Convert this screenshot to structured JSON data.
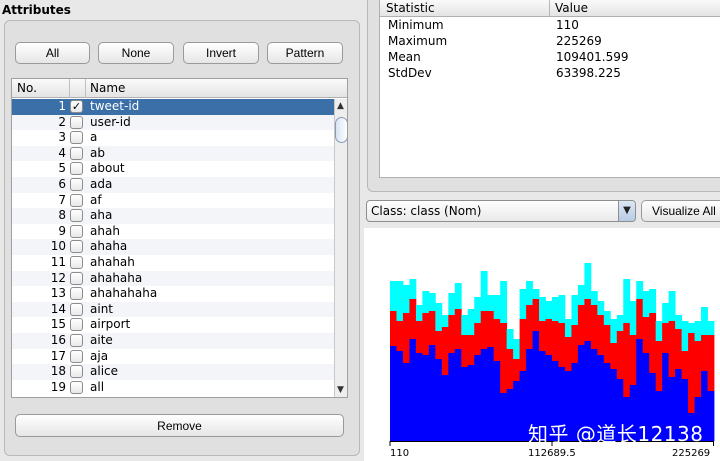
{
  "attributes": {
    "title": "Attributes",
    "buttons": {
      "all": "All",
      "none": "None",
      "invert": "Invert",
      "pattern": "Pattern",
      "remove": "Remove"
    },
    "columns": {
      "no": "No.",
      "name": "Name"
    },
    "rows": [
      {
        "no": "1",
        "name": "tweet-id",
        "checked": true,
        "selected": true
      },
      {
        "no": "2",
        "name": "user-id",
        "checked": false
      },
      {
        "no": "3",
        "name": "a",
        "checked": false
      },
      {
        "no": "4",
        "name": "ab",
        "checked": false
      },
      {
        "no": "5",
        "name": "about",
        "checked": false
      },
      {
        "no": "6",
        "name": "ada",
        "checked": false
      },
      {
        "no": "7",
        "name": "af",
        "checked": false
      },
      {
        "no": "8",
        "name": "aha",
        "checked": false
      },
      {
        "no": "9",
        "name": "ahah",
        "checked": false
      },
      {
        "no": "10",
        "name": "ahaha",
        "checked": false
      },
      {
        "no": "11",
        "name": "ahahah",
        "checked": false
      },
      {
        "no": "12",
        "name": "ahahaha",
        "checked": false
      },
      {
        "no": "13",
        "name": "ahahahaha",
        "checked": false
      },
      {
        "no": "14",
        "name": "aint",
        "checked": false
      },
      {
        "no": "15",
        "name": "airport",
        "checked": false
      },
      {
        "no": "16",
        "name": "aite",
        "checked": false
      },
      {
        "no": "17",
        "name": "aja",
        "checked": false
      },
      {
        "no": "18",
        "name": "alice",
        "checked": false
      },
      {
        "no": "19",
        "name": "all",
        "checked": false
      }
    ]
  },
  "statistics": {
    "columns": {
      "statistic": "Statistic",
      "value": "Value"
    },
    "rows": [
      {
        "k": "Minimum",
        "v": "110"
      },
      {
        "k": "Maximum",
        "v": "225269"
      },
      {
        "k": "Mean",
        "v": "109401.599"
      },
      {
        "k": "StdDev",
        "v": "63398.225"
      }
    ]
  },
  "class_selector": {
    "value": "Class: class (Nom)",
    "visualize_label": "Visualize All"
  },
  "icons": {
    "check": "checkmark-icon",
    "dropdown": "chevron-down-icon",
    "scroll_up": "arrow-up-icon",
    "scroll_down": "arrow-down-icon"
  },
  "colors": {
    "class_a": "#0000ff",
    "class_b": "#ff0000",
    "class_c": "#00ffff",
    "selection": "#3b6fa8"
  },
  "histogram": {
    "axis_min": "110",
    "axis_mid": "112689.5",
    "axis_max": "225269",
    "watermark": "知乎 @道长12138"
  },
  "chart_data": {
    "type": "bar",
    "stacked": true,
    "x_range": [
      110,
      225269
    ],
    "bins": 50,
    "series": [
      {
        "color": "#0000ff",
        "values": [
          95,
          90,
          78,
          102,
          88,
          86,
          96,
          82,
          66,
          88,
          92,
          74,
          76,
          86,
          92,
          94,
          80,
          48,
          52,
          60,
          70,
          92,
          110,
          90,
          86,
          80,
          74,
          70,
          78,
          96,
          100,
          92,
          86,
          78,
          72,
          62,
          44,
          56,
          102,
          88,
          68,
          50,
          88,
          64,
          72,
          62,
          28,
          44,
          70,
          50
        ]
      },
      {
        "color": "#ff0000",
        "values": [
          35,
          30,
          50,
          40,
          32,
          42,
          34,
          28,
          48,
          38,
          40,
          32,
          30,
          32,
          38,
          36,
          42,
          70,
          40,
          22,
          52,
          44,
          32,
          30,
          36,
          40,
          44,
          34,
          38,
          40,
          42,
          44,
          40,
          38,
          26,
          48,
          74,
          50,
          40,
          36,
          60,
          50,
          30,
          56,
          40,
          28,
          80,
          56,
          36,
          56
        ]
      },
      {
        "color": "#00ffff",
        "values": [
          30,
          40,
          28,
          20,
          16,
          22,
          18,
          28,
          12,
          22,
          26,
          20,
          26,
          26,
          40,
          16,
          24,
          42,
          20,
          20,
          30,
          24,
          10,
          24,
          18,
          24,
          28,
          18,
          30,
          20,
          36,
          14,
          14,
          14,
          24,
          16,
          44,
          34,
          18,
          26,
          24,
          20,
          20,
          30,
          14,
          30,
          10,
          20,
          28,
          14
        ]
      }
    ]
  }
}
